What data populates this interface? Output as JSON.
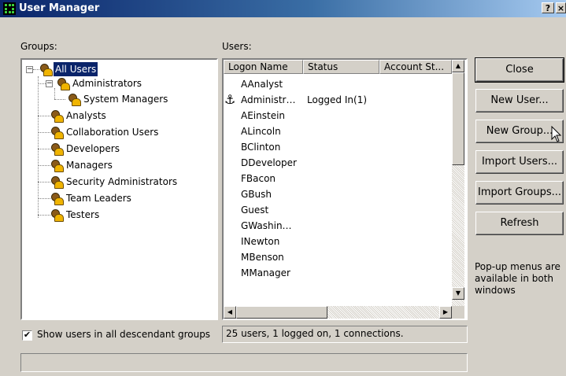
{
  "window": {
    "title": "User Manager",
    "help_button": "?",
    "close_button": "×"
  },
  "groups": {
    "label": "Groups:",
    "tree": [
      {
        "label": "All Users",
        "selected": true
      },
      {
        "label": "Administrators"
      },
      {
        "label": "System Managers"
      },
      {
        "label": "Analysts"
      },
      {
        "label": "Collaboration Users"
      },
      {
        "label": "Developers"
      },
      {
        "label": "Managers"
      },
      {
        "label": "Security Administrators"
      },
      {
        "label": "Team Leaders"
      },
      {
        "label": "Testers"
      }
    ],
    "expander_collapse": "−"
  },
  "users": {
    "label": "Users:",
    "columns": [
      "Logon Name",
      "Status",
      "Account St..."
    ],
    "rows": [
      {
        "name": "AAnalyst",
        "status": "",
        "anchor_icon": false
      },
      {
        "name": "Administr…",
        "status": "Logged In(1)",
        "anchor_icon": true
      },
      {
        "name": "AEinstein",
        "status": ""
      },
      {
        "name": "ALincoln",
        "status": ""
      },
      {
        "name": "BClinton",
        "status": ""
      },
      {
        "name": "DDeveloper",
        "status": ""
      },
      {
        "name": "FBacon",
        "status": ""
      },
      {
        "name": "GBush",
        "status": ""
      },
      {
        "name": "Guest",
        "status": ""
      },
      {
        "name": "GWashin…",
        "status": ""
      },
      {
        "name": "INewton",
        "status": ""
      },
      {
        "name": "MBenson",
        "status": ""
      },
      {
        "name": "MManager",
        "status": ""
      }
    ],
    "anchor_glyph": "⚓",
    "status_text": "25 users, 1 logged on, 1 connections."
  },
  "buttons": {
    "close": "Close",
    "new_user": "New User...",
    "new_group": "New Group...",
    "import_users": "Import Users...",
    "import_groups": "Import Groups...",
    "refresh": "Refresh"
  },
  "help_text": "Pop-up menus are available in both windows",
  "show_descendants": {
    "label": "Show users in all descendant groups",
    "checked": "✔"
  },
  "bottom_status": ""
}
